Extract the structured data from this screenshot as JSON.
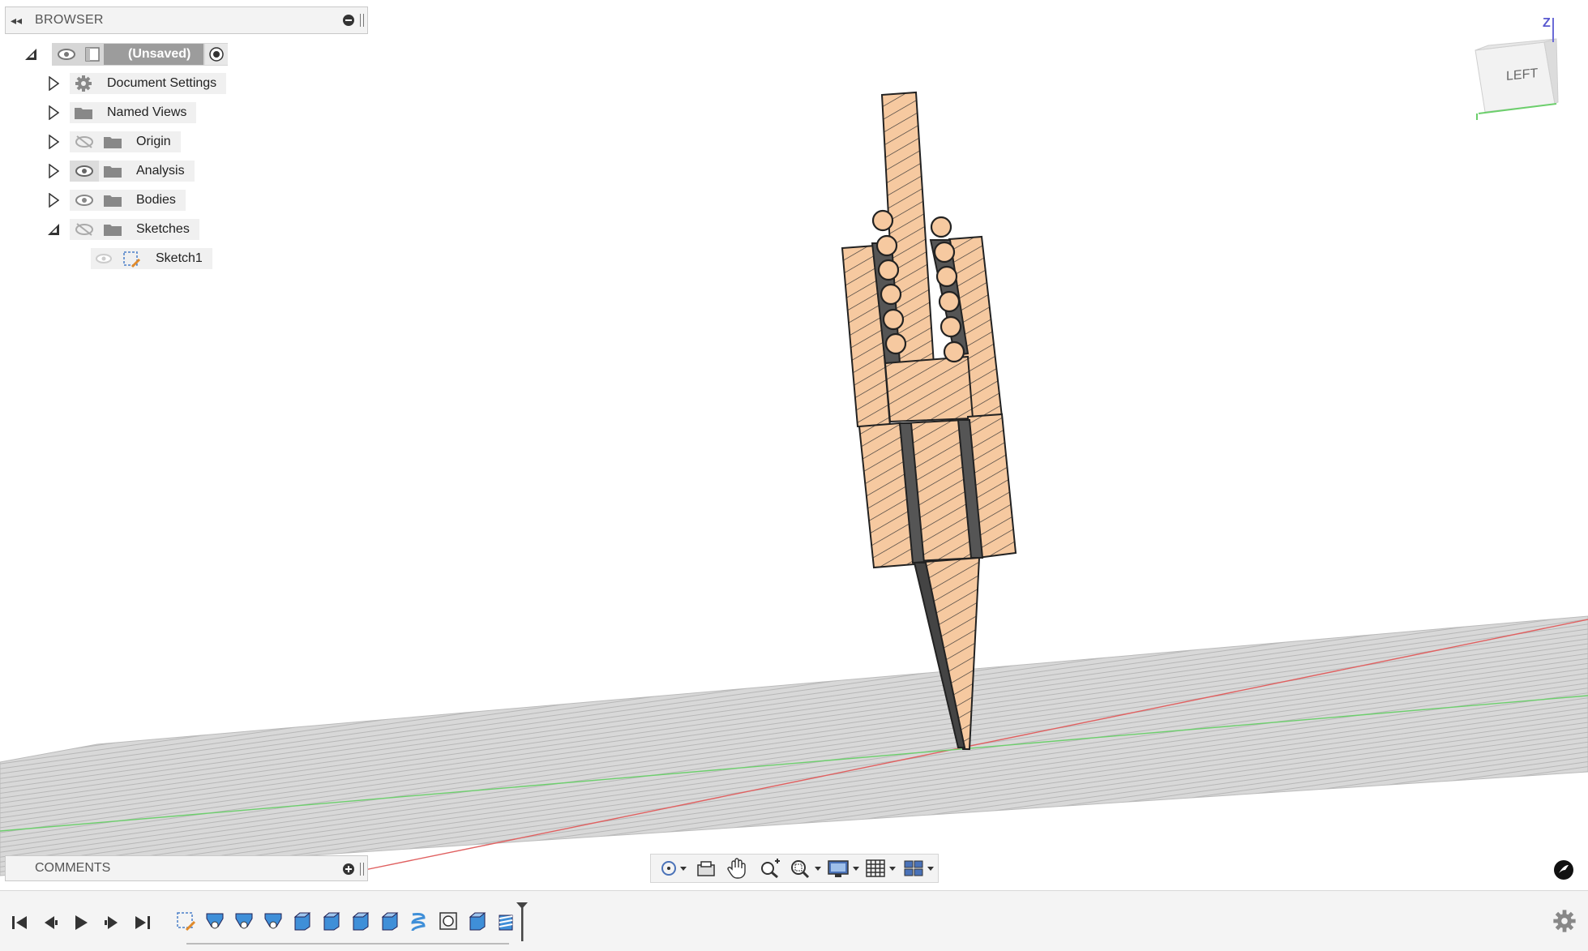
{
  "browser": {
    "title": "BROWSER",
    "root_label": "(Unsaved)",
    "items": [
      {
        "label": "Document Settings",
        "icon": "gear-icon"
      },
      {
        "label": "Named Views",
        "icon": "folder-icon"
      },
      {
        "label": "Origin",
        "icon": "folder-icon",
        "visibility": "hidden"
      },
      {
        "label": "Analysis",
        "icon": "folder-icon",
        "visibility": "visible"
      },
      {
        "label": "Bodies",
        "icon": "folder-icon",
        "visibility": "visible"
      },
      {
        "label": "Sketches",
        "icon": "folder-icon",
        "visibility": "hidden",
        "expanded": true
      },
      {
        "label": "Sketch1",
        "icon": "sketch-icon",
        "visibility": "dimmed"
      }
    ]
  },
  "comments": {
    "title": "COMMENTS"
  },
  "viewcube": {
    "face_label": "LEFT",
    "axis_label": "Z"
  },
  "navbar": {
    "tools": [
      "orbit-icon",
      "look-at-icon",
      "pan-icon",
      "zoom-icon",
      "fit-icon",
      "display-settings-icon",
      "grid-icon",
      "viewports-icon"
    ]
  },
  "timeline": {
    "controls": [
      "skip-to-start-icon",
      "step-back-icon",
      "play-icon",
      "step-forward-icon",
      "skip-to-end-icon"
    ],
    "features": [
      "sketch-icon",
      "revolve-icon",
      "revolve-icon",
      "revolve-icon",
      "extrude-icon",
      "extrude-icon",
      "extrude-icon",
      "extrude-icon",
      "coil-icon",
      "section-icon",
      "extrude-icon",
      "thread-icon"
    ]
  },
  "colors": {
    "part_fill": "#f6c9a0",
    "hatch": "#333333",
    "ground": "#d9d9d9",
    "x_axis": "#e06060",
    "y_axis": "#6ccf6c",
    "feature_blue": "#3f8fd8"
  }
}
